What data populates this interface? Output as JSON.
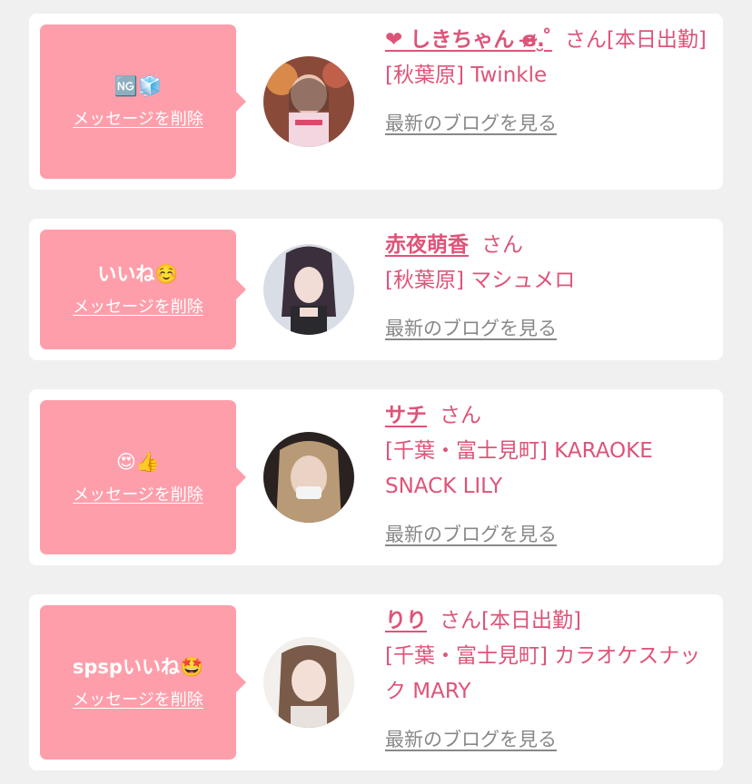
{
  "colors": {
    "accent": "#dd5478",
    "bubble": "#ff9eab",
    "background": "#f0f0f0",
    "muted": "#888888"
  },
  "delete_label": "メッセージを削除",
  "blog_label": "最新のブログを見る",
  "cards": [
    {
      "message": "🆖🧊",
      "name": "❤ しきちゃん ɞ̴̶̷.̮ ̊",
      "suffix": "さん[本日出勤]",
      "shop": "[秋葉原] Twinkle"
    },
    {
      "message": "いいね☺️",
      "name": "赤夜萌香",
      "suffix": "さん",
      "shop": "[秋葉原] マシュメロ"
    },
    {
      "message": "😍👍",
      "name": "サチ",
      "suffix": "さん",
      "shop": "[千葉・富士見町] KARAOKE SNACK LILY"
    },
    {
      "message": "spspいいね🤩",
      "name": "りり",
      "suffix": "さん[本日出勤]",
      "shop": "[千葉・富士見町] カラオケスナック MARY"
    }
  ]
}
